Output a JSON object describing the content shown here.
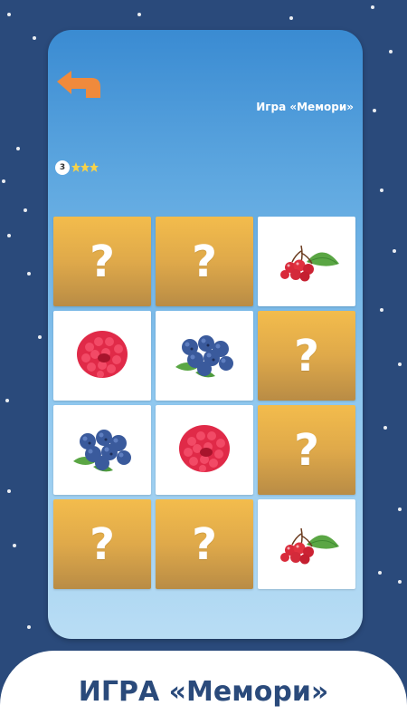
{
  "header": {
    "title": "Игра «Мемори»",
    "back_icon": "back-arrow-icon",
    "score": "3"
  },
  "board": {
    "rows": 4,
    "cols": 3,
    "cards": [
      {
        "state": "hidden",
        "label": "?"
      },
      {
        "state": "hidden",
        "label": "?"
      },
      {
        "state": "open",
        "fruit": "hawthorn"
      },
      {
        "state": "open",
        "fruit": "raspberry"
      },
      {
        "state": "open",
        "fruit": "blueberry"
      },
      {
        "state": "hidden",
        "label": "?"
      },
      {
        "state": "open",
        "fruit": "blueberry"
      },
      {
        "state": "open",
        "fruit": "raspberry"
      },
      {
        "state": "hidden",
        "label": "?"
      },
      {
        "state": "hidden",
        "label": "?"
      },
      {
        "state": "hidden",
        "label": "?"
      },
      {
        "state": "open",
        "fruit": "hawthorn"
      }
    ]
  },
  "footer": {
    "caption": "ИГРА «Мемори»"
  },
  "colors": {
    "background": "#2a4a7b",
    "card_back": "#e3ac4a",
    "back_button": "#f08a3c"
  }
}
